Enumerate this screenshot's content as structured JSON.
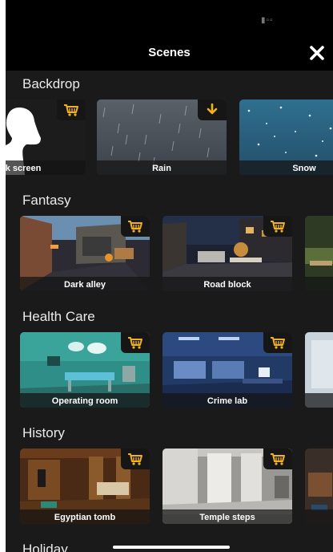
{
  "header": {
    "title": "Scenes",
    "close_icon": "close-icon"
  },
  "status": {
    "indicator": "▮▫▫"
  },
  "colors": {
    "badge_icon": "#f2b21c",
    "background": "#1a1a1a"
  },
  "sections": [
    {
      "title": "Backdrop",
      "cards": [
        {
          "label": "ck screen",
          "badge": "cart-icon"
        },
        {
          "label": "Rain",
          "badge": "download-icon"
        },
        {
          "label": "Snow",
          "badge": ""
        }
      ]
    },
    {
      "title": "Fantasy",
      "cards": [
        {
          "label": "Dark alley",
          "badge": "cart-icon"
        },
        {
          "label": "Road block",
          "badge": "cart-icon"
        },
        {
          "label": "",
          "badge": ""
        }
      ]
    },
    {
      "title": "Health Care",
      "cards": [
        {
          "label": "Operating room",
          "badge": "cart-icon"
        },
        {
          "label": "Crime lab",
          "badge": "cart-icon"
        },
        {
          "label": "",
          "badge": ""
        }
      ]
    },
    {
      "title": "History",
      "cards": [
        {
          "label": "Egyptian tomb",
          "badge": "cart-icon"
        },
        {
          "label": "Temple steps",
          "badge": "cart-icon"
        },
        {
          "label": "",
          "badge": ""
        }
      ]
    },
    {
      "title": "Holiday",
      "cards": []
    }
  ]
}
